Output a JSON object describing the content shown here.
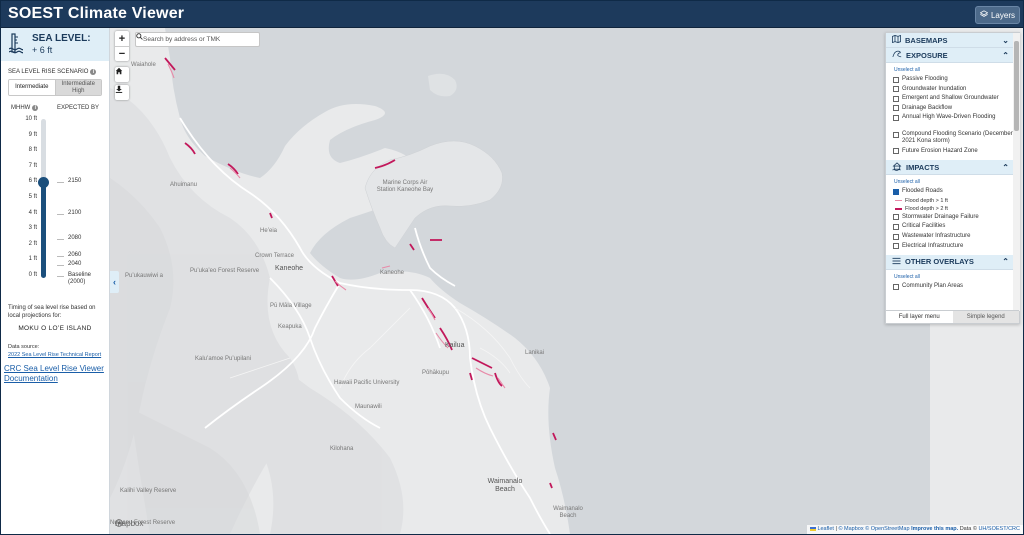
{
  "header": {
    "title": "SOEST Climate Viewer",
    "layers_button": "Layers"
  },
  "left_panel": {
    "sea_level_title": "SEA LEVEL:",
    "sea_level_value": "+ 6 ft",
    "scenario_label": "SEA LEVEL RISE SCENARIO",
    "scenario_options": [
      "Intermediate",
      "Intermediate High"
    ],
    "scenario_selected": "Intermediate",
    "col_mhhw": "MHHW",
    "col_expected": "EXPECTED BY",
    "ticks": [
      "10 ft",
      "9 ft",
      "8 ft",
      "7 ft",
      "6 ft",
      "5 ft",
      "4 ft",
      "3 ft",
      "2 ft",
      "1 ft",
      "0 ft"
    ],
    "selected_ft": 6,
    "max_ft": 10,
    "years": [
      {
        "ft": 6,
        "label": "2150"
      },
      {
        "ft": 4,
        "label": "2100"
      },
      {
        "ft": 2.4,
        "label": "2080"
      },
      {
        "ft": 1.3,
        "label": "2060"
      },
      {
        "ft": 0.7,
        "label": "2040"
      },
      {
        "ft": 0,
        "label": "Baseline (2000)"
      }
    ],
    "timing_text": "Timing of sea level rise based on local projections for:",
    "island": "MOKU O LOʻE ISLAND",
    "data_source_label": "Data source:",
    "data_source_link": "2022 Sea Level Rise Technical Report",
    "doc_link": "CRC Sea Level Rise Viewer Documentation"
  },
  "map": {
    "search_placeholder": "Search by address or TMK",
    "places": [
      {
        "name": "Waiahole",
        "cls": ""
      },
      {
        "name": "Ahuimanu",
        "cls": ""
      },
      {
        "name": "Heʻeia",
        "cls": ""
      },
      {
        "name": "Crown Terrace",
        "cls": ""
      },
      {
        "name": "Kaneohe",
        "cls": "big"
      },
      {
        "name": "Puʻukaʻeo Forest Reserve",
        "cls": ""
      },
      {
        "name": "Puʻukauwiwi a",
        "cls": ""
      },
      {
        "name": "Pū Māla Village",
        "cls": ""
      },
      {
        "name": "Keapuka",
        "cls": ""
      },
      {
        "name": "Kailua",
        "cls": "big"
      },
      {
        "name": "Kaluʻamoe Puʻupilani",
        "cls": ""
      },
      {
        "name": "Hawaii Pacific University",
        "cls": ""
      },
      {
        "name": "Pōhākupu",
        "cls": ""
      },
      {
        "name": "Maunawili",
        "cls": ""
      },
      {
        "name": "Kilohana",
        "cls": ""
      },
      {
        "name": "Waimanalo Beach",
        "cls": "big"
      },
      {
        "name": "Waimanalo Beach",
        "cls": ""
      },
      {
        "name": "Marine Corps Air Station Kaneohe Bay",
        "cls": ""
      },
      {
        "name": "Kaneohe",
        "cls": ""
      },
      {
        "name": "Lanikai",
        "cls": ""
      },
      {
        "name": "Kalihi Valley Reserve",
        "cls": ""
      },
      {
        "name": "Nuʻuanu Forest Reserve",
        "cls": ""
      }
    ],
    "mapbox": "mapbox",
    "attribution": {
      "leaflet": "Leaflet",
      "mapbox": "© Mapbox",
      "osm": "© OpenStreetMap",
      "improve": "Improve this map.",
      "data": "Data ©",
      "source": "UH/SOEST/CRC"
    }
  },
  "layers_panel": {
    "basemaps": "BASEMAPS",
    "exposure": "EXPOSURE",
    "exposure_unselect": "Unselect all",
    "exposure_items": [
      "Passive Flooding",
      "Groundwater Inundation",
      "Emergent and Shallow Groundwater",
      "Drainage Backflow",
      "Annual High Wave-Driven Flooding"
    ],
    "exposure_items2": [
      "Compound Flooding Scenario (December 2021 Kona storm)",
      "Future Erosion Hazard Zone"
    ],
    "impacts": "IMPACTS",
    "impacts_unselect": "Unselect all",
    "flooded_roads": "Flooded Roads",
    "legend_1": "Flood depth > 1 ft",
    "legend_2": "Flood depth > 2 ft",
    "impact_items": [
      "Stormwater Drainage Failure",
      "Critical Facilities",
      "Wastewater Infrastructure",
      "Electrical Infrastructure"
    ],
    "other": "OTHER OVERLAYS",
    "other_unselect": "Unselect all",
    "other_items": [
      "Community Plan Areas"
    ],
    "tab_full": "Full layer menu",
    "tab_simple": "Simple legend"
  },
  "colors": {
    "header": "#1d3a5c",
    "accent": "#1b4f7c",
    "flood1": "#e88aa8",
    "flood2": "#c2185b",
    "water": "#d3d7db",
    "land": "#e9eaeb"
  }
}
